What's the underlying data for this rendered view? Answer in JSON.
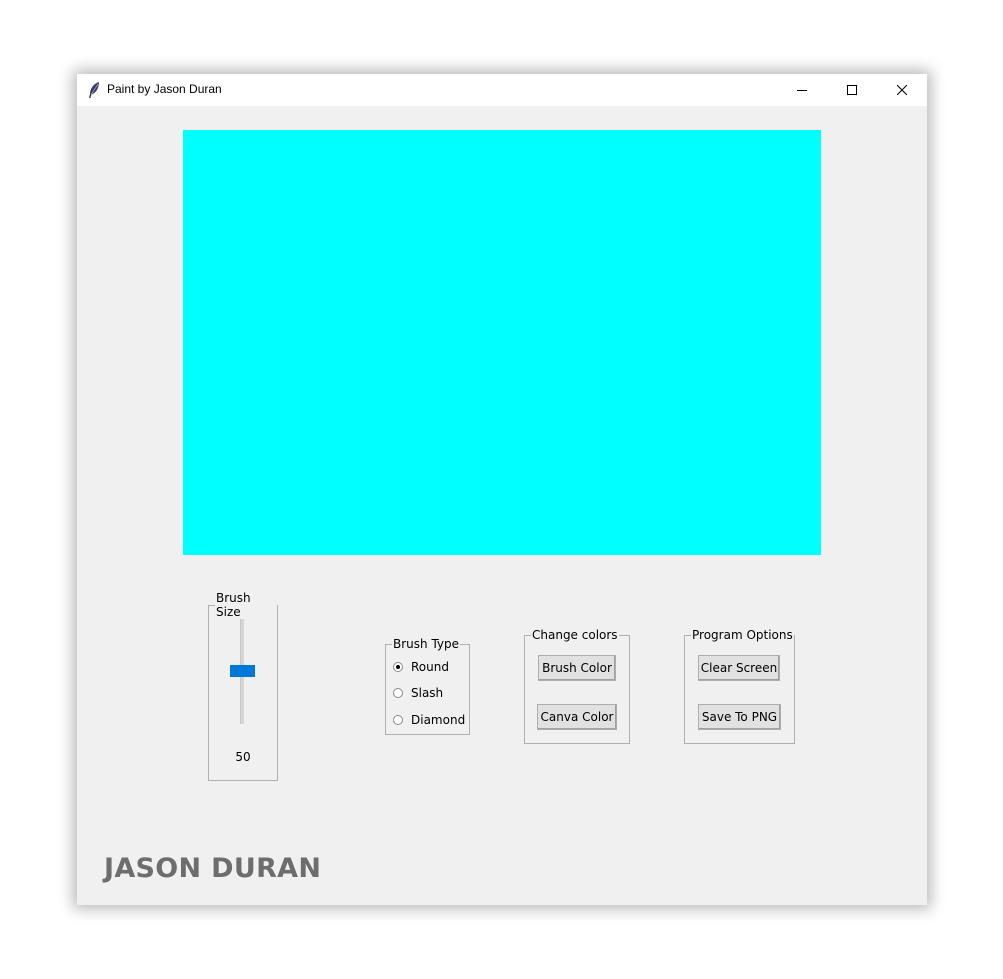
{
  "window": {
    "title": "Paint by Jason Duran",
    "controls": [
      "minimize-icon",
      "maximize-icon",
      "close-icon"
    ]
  },
  "canvas": {
    "background_color": "#00ffff"
  },
  "brush_size": {
    "label": "Brush Size",
    "value": "50",
    "thumb_color": "#0078d7"
  },
  "brush_type": {
    "label": "Brush Type",
    "options": [
      {
        "label": "Round",
        "checked": true
      },
      {
        "label": "Slash",
        "checked": false
      },
      {
        "label": "Diamond",
        "checked": false
      }
    ]
  },
  "change_colors": {
    "label": "Change colors",
    "brush_color": "Brush Color",
    "canva_color": "Canva Color"
  },
  "program_options": {
    "label": "Program Options",
    "clear_screen": "Clear Screen",
    "save_to_png": "Save To PNG"
  },
  "brand": {
    "text": "JASON DURAN",
    "color": "#6d6d6d"
  }
}
